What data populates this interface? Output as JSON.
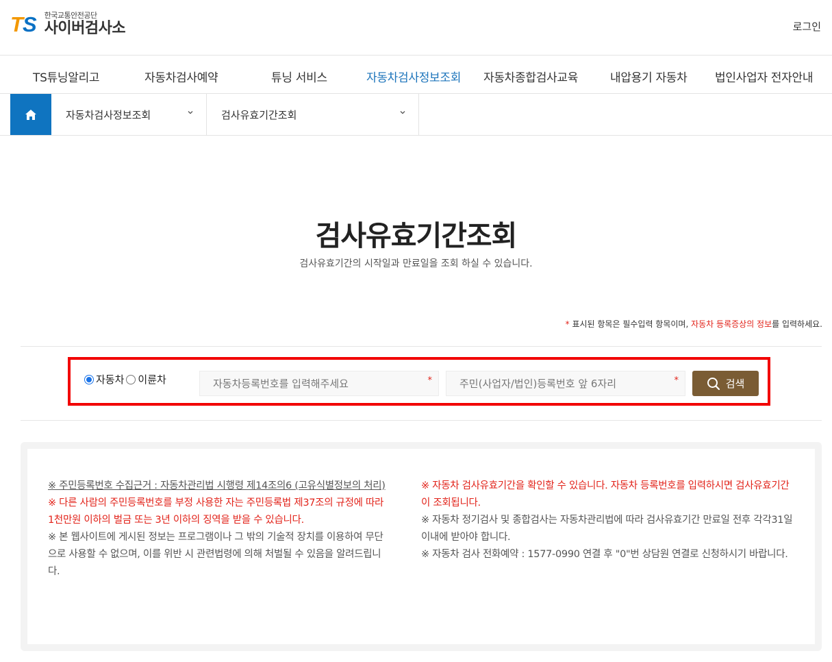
{
  "header": {
    "logo_ts_t": "T",
    "logo_ts_s": "S",
    "org_name": "한국교통안전공단",
    "site_name": "사이버검사소",
    "login_label": "로그인"
  },
  "gnb": {
    "items": [
      {
        "label": "TS튜닝알리고"
      },
      {
        "label": "자동차검사예약"
      },
      {
        "label": "튜닝 서비스"
      },
      {
        "label": "자동차검사정보조회"
      },
      {
        "label": "자동차종합검사교육"
      },
      {
        "label": "내압용기 자동차"
      },
      {
        "label": "법인사업자 전자안내"
      }
    ],
    "active_index": 3
  },
  "breadcrumb": {
    "level1": "자동차검사정보조회",
    "level2": "검사유효기간조회"
  },
  "page": {
    "title": "검사유효기간조회",
    "subtitle": "검사유효기간의 시작일과 만료일을 조회 하실 수 있습니다.",
    "required_note_star": "*",
    "required_note_1": " 표시된 항목은 필수입력 항목이며, ",
    "required_note_red": "자동차 등록증상의 정보",
    "required_note_2": "를 입력하세요."
  },
  "search": {
    "radio_car": "자동차",
    "radio_motorcycle": "이륜차",
    "selected": "자동차",
    "plate_placeholder": "자동차등록번호를 입력해주세요",
    "id_placeholder": "주민(사업자/법인)등록번호 앞 6자리",
    "required_star": "*",
    "button_label": "검색"
  },
  "notice": {
    "left": {
      "line1_underlined": "※ 주민등록번호 수집근거 : 자동차관리법 시행령 제14조의6 (고유식별정보의 처리)",
      "line2_red": "※ 다른 사람의 주민등록번호를 부정 사용한 자는 주민등록법 제37조의 규정에 따라 1천만원 이하의 벌금 또는 3년 이하의 징역을 받을 수 있습니다.",
      "line3": "※ 본 웹사이트에 게시된 정보는 프로그램이나 그 밖의 기술적 장치를 이용하여 무단으로 사용할 수 없으며, 이를 위반 시 관련법령에 의해 처벌될 수 있음을 알려드립니다."
    },
    "right": {
      "line1_red": "※ 자동차 검사유효기간을 확인할 수 있습니다. 자동차 등록번호를 입력하시면 검사유효기간이 조회됩니다.",
      "line2": "※ 자동차 정기검사 및 종합검사는 자동차관리법에 따라 검사유효기간 만료일 전후 각각31일 이내에 받아야 합니다.",
      "line3": "※ 자동차 검사 전화예약 : 1577-0990 연결 후 \"0\"번 상담원 연결로 신청하시기 바랍니다."
    }
  },
  "colors": {
    "brand_blue": "#0f74c0",
    "brand_orange": "#f39800",
    "active_menu": "#1c74bb",
    "search_button": "#7a5c34",
    "highlight_border": "#f20000",
    "warning_red": "#e2231a"
  }
}
